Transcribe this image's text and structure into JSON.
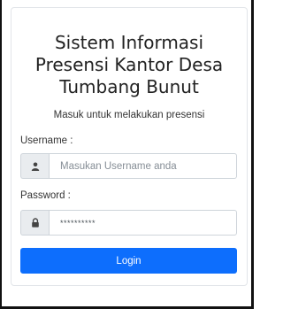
{
  "app": {
    "title_lines": [
      "Sistem Informasi",
      "Presensi Kantor Desa",
      "Tumbang Bunut"
    ],
    "subtitle": "Masuk untuk melakukan presensi"
  },
  "form": {
    "username_label": "Username :",
    "username_placeholder": "Masukan Username anda",
    "username_value": "",
    "username_icon": "user-icon",
    "password_label": "Password :",
    "password_value": "**********",
    "password_icon": "lock-icon",
    "login_label": "Login"
  },
  "colors": {
    "primary": "#0d6efd",
    "addon_bg": "#e9ecef",
    "border": "#ced4da"
  }
}
